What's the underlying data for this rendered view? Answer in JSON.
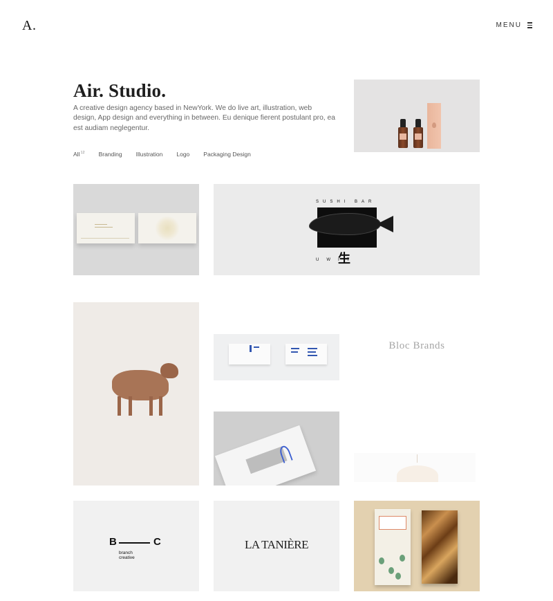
{
  "header": {
    "logo": "A.",
    "menu_label": "MENU"
  },
  "intro": {
    "title": "Air. Studio.",
    "description": "A creative design agency based in NewYork. We do live art, illustration, web design, App design and everything in between. Eu denique fierent postulant pro, ea est audiam neglegentur."
  },
  "filters": [
    {
      "label": "All",
      "count": "12"
    },
    {
      "label": "Branding"
    },
    {
      "label": "Illustration"
    },
    {
      "label": "Logo"
    },
    {
      "label": "Packaging Design"
    }
  ],
  "portfolio": {
    "sushi": {
      "top_text": "SUSHI BAR",
      "bottom_text": "UWIT",
      "side_letter": "K",
      "kanji": "生"
    },
    "bloc_brands": "Bloc Brands",
    "branch_creative": {
      "left_letter": "B",
      "right_letter": "C",
      "subtitle_line1": "branch",
      "subtitle_line2": "creative"
    },
    "la_taniere": "LA TANIÈRE"
  },
  "icons": {
    "menu": "hamburger-icon"
  }
}
